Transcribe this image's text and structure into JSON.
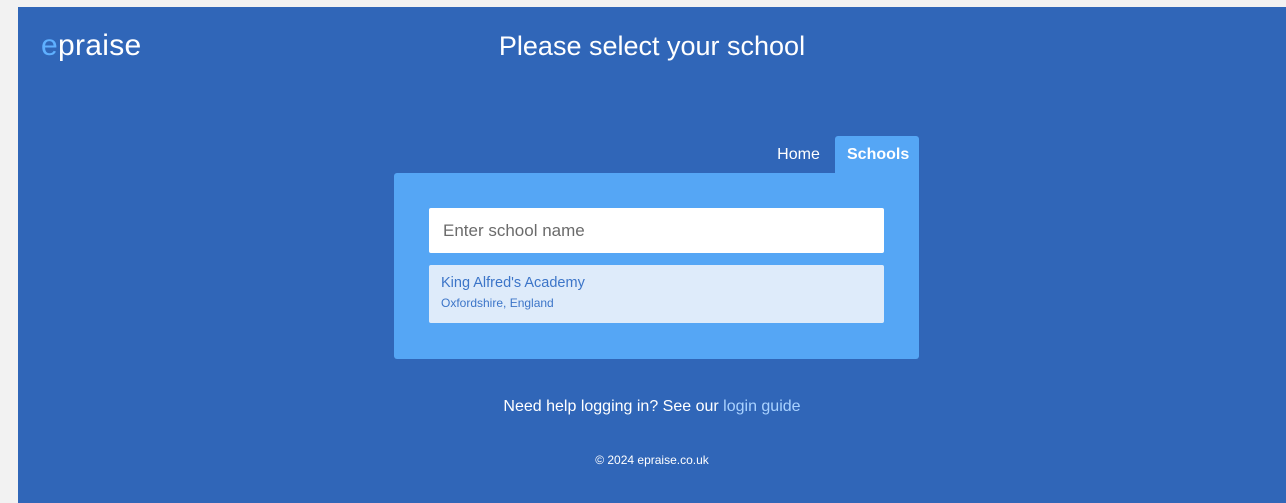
{
  "header": {
    "logo_first": "e",
    "logo_rest": "praise",
    "title": "Please select your school"
  },
  "tabs": [
    {
      "label": "Home"
    },
    {
      "label": "Schools"
    }
  ],
  "search": {
    "placeholder": "Enter school name",
    "value": ""
  },
  "results": [
    {
      "name": "King Alfred's Academy",
      "location": "Oxfordshire, England"
    }
  ],
  "help": {
    "text": "Need help logging in? See our",
    "link": "login guide"
  },
  "footer": {
    "copyright": "© 2024 epraise.co.uk"
  },
  "colors": {
    "background": "#3066b8",
    "panel": "#55a6f5",
    "logo_accent": "#5fb0ff",
    "link": "#a9d2ff",
    "result_bg": "#deebfa",
    "result_text": "#3c75c8"
  }
}
